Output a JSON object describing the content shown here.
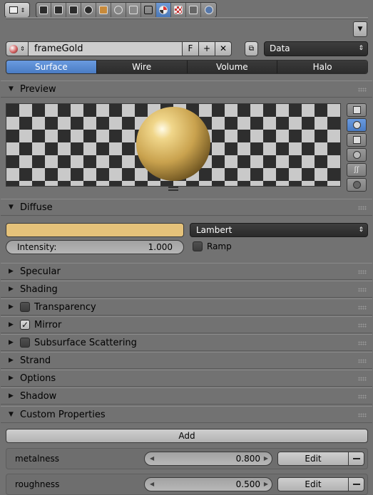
{
  "header": {
    "editor_menu_icon": "editor-type-icon",
    "context_tabs": [
      "render",
      "render-layers",
      "scene",
      "world",
      "object",
      "constraints",
      "modifiers",
      "data",
      "material",
      "texture",
      "particles",
      "physics"
    ],
    "active_tab": "material"
  },
  "datablock": {
    "name": "frameGold",
    "fake_user": "F",
    "add_icon": "+",
    "unlink_icon": "✕",
    "link_value": "Data"
  },
  "type_tabs": [
    {
      "label": "Surface",
      "selected": true
    },
    {
      "label": "Wire",
      "selected": false
    },
    {
      "label": "Volume",
      "selected": false
    },
    {
      "label": "Halo",
      "selected": false
    }
  ],
  "panels": {
    "preview": {
      "label": "Preview"
    },
    "diffuse": {
      "label": "Diffuse",
      "color": "#e5c27a",
      "shader": "Lambert",
      "intensity_label": "Intensity:",
      "intensity_value": "1.000",
      "ramp_label": "Ramp"
    },
    "specular": {
      "label": "Specular"
    },
    "shading": {
      "label": "Shading"
    },
    "transparency": {
      "label": "Transparency",
      "checked": false
    },
    "mirror": {
      "label": "Mirror",
      "checked": true
    },
    "sss": {
      "label": "Subsurface Scattering",
      "checked": false
    },
    "strand": {
      "label": "Strand"
    },
    "options": {
      "label": "Options"
    },
    "shadow": {
      "label": "Shadow"
    },
    "custom": {
      "label": "Custom Properties",
      "add_label": "Add",
      "props": [
        {
          "name": "metalness",
          "value": "0.800",
          "edit": "Edit"
        },
        {
          "name": "roughness",
          "value": "0.500",
          "edit": "Edit"
        }
      ]
    }
  },
  "colors": {
    "accent": "#5a8ad0",
    "panel_bg": "#727272",
    "gold": "#e5c27a"
  }
}
